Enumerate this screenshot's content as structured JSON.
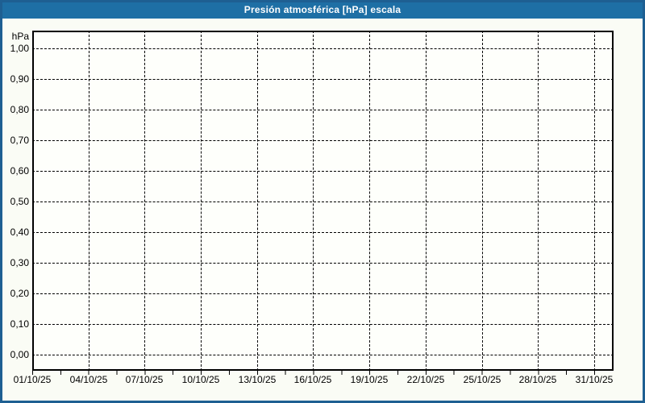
{
  "window": {
    "title": "Presión atmosférica [hPa] escala"
  },
  "colors": {
    "titlebar_background": "#1E6FA5",
    "frame_border": "#1E5F92",
    "content_background": "#FAFCF5",
    "plot_background": "#FEFFFB",
    "grid_and_text": "#000000",
    "title_text": "#FFFFFF"
  },
  "chart_data": {
    "type": "line",
    "title": "Presión atmosférica [hPa] escala",
    "ylabel": "hPa",
    "xlabel": "",
    "ylim": [
      0.0,
      1.0
    ],
    "y_tick_step": 0.1,
    "y_tick_labels": [
      "1,00",
      "0,90",
      "0,80",
      "0,70",
      "0,60",
      "0,50",
      "0,40",
      "0,30",
      "0,20",
      "0,10",
      "0,00"
    ],
    "x_tick_labels": [
      "01/10/25",
      "04/10/25",
      "07/10/25",
      "10/10/25",
      "13/10/25",
      "16/10/25",
      "19/10/25",
      "22/10/25",
      "25/10/25",
      "28/10/25",
      "31/10/25"
    ],
    "x_range": [
      "01/10/25",
      "31/10/25"
    ],
    "grid": "dashed, both axes, on",
    "legend_position": "none",
    "series": [],
    "note_visible_content": "empty pressure-scale chart grid, no data series plotted"
  }
}
